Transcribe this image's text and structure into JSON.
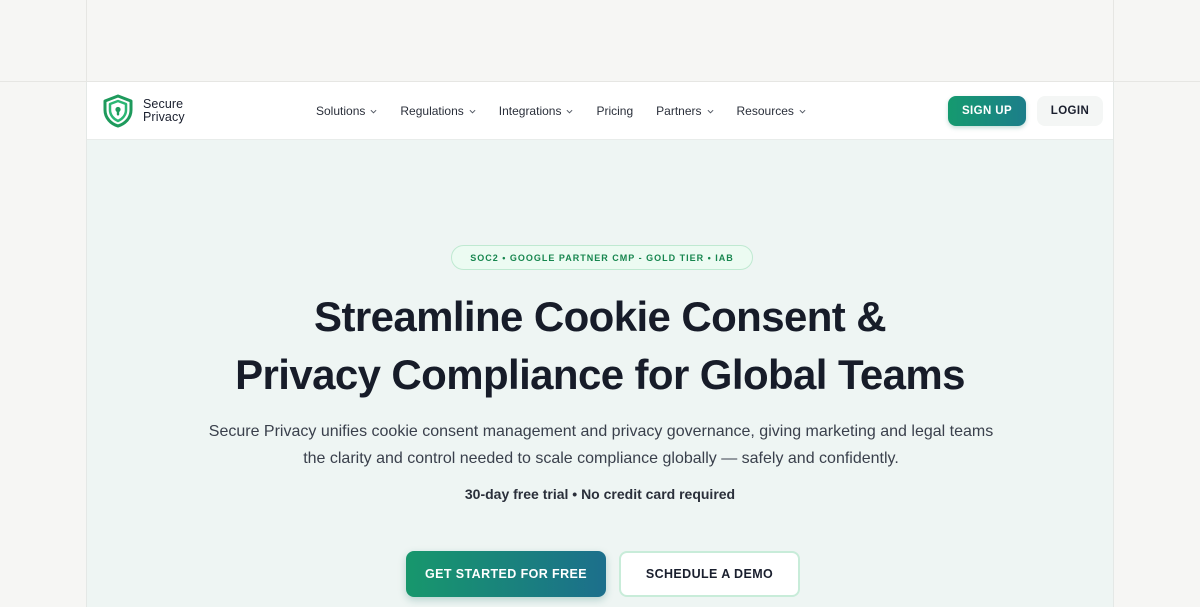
{
  "brand": {
    "name_line1": "Secure",
    "name_line2": "Privacy",
    "logo_icon": "shield-lock-icon",
    "accent_color": "#159a6f"
  },
  "nav": {
    "items": [
      {
        "label": "Solutions",
        "has_dropdown": true
      },
      {
        "label": "Regulations",
        "has_dropdown": true
      },
      {
        "label": "Integrations",
        "has_dropdown": true
      },
      {
        "label": "Pricing",
        "has_dropdown": false
      },
      {
        "label": "Partners",
        "has_dropdown": true
      },
      {
        "label": "Resources",
        "has_dropdown": true
      }
    ],
    "signup_label": "SIGN UP",
    "login_label": "LOGIN"
  },
  "hero": {
    "badge": "SOC2 • GOOGLE PARTNER CMP - GOLD TIER • IAB",
    "headline_line1": "Streamline Cookie Consent &",
    "headline_line2": "Privacy Compliance for Global Teams",
    "subtext_line1": "Secure Privacy unifies cookie consent management and privacy governance, giving marketing and legal teams",
    "subtext_line2": "the clarity and control needed to scale compliance globally — safely and confidently.",
    "trial_note": "30-day free trial • No credit card required",
    "primary_cta": "GET STARTED FOR FREE",
    "secondary_cta": "SCHEDULE A DEMO"
  }
}
